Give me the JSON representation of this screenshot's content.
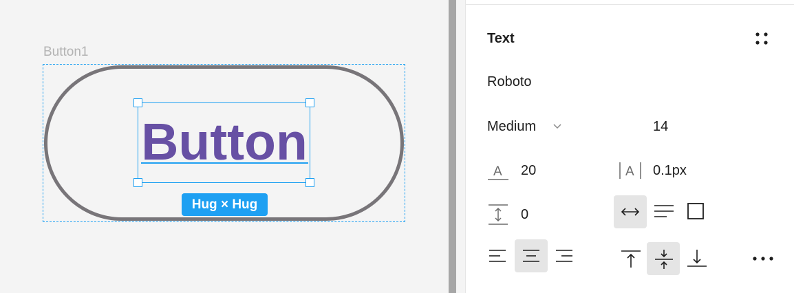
{
  "canvas": {
    "frame_label": "Button1",
    "button_text": "Button",
    "size_badge": "Hug × Hug",
    "colors": {
      "selection": "#1ea0f2",
      "text": "#6750a4",
      "outline": "#787579"
    }
  },
  "panel": {
    "title": "Text",
    "font_family": "Roboto",
    "font_weight": "Medium",
    "font_size": "14",
    "line_height": "20",
    "letter_spacing": "0.1px",
    "paragraph_spacing": "0",
    "icons": {
      "more_grid": "grid-dots-icon",
      "resize": [
        "auto-width-icon",
        "auto-height-icon",
        "fixed-size-icon"
      ],
      "align_horizontal": [
        "align-left-icon",
        "align-center-icon",
        "align-right-icon"
      ],
      "align_vertical": [
        "align-top-icon",
        "align-middle-icon",
        "align-bottom-icon"
      ],
      "more": "more-options-icon"
    },
    "selected": {
      "resize": "auto-width",
      "align_horizontal": "center",
      "align_vertical": "middle"
    }
  }
}
